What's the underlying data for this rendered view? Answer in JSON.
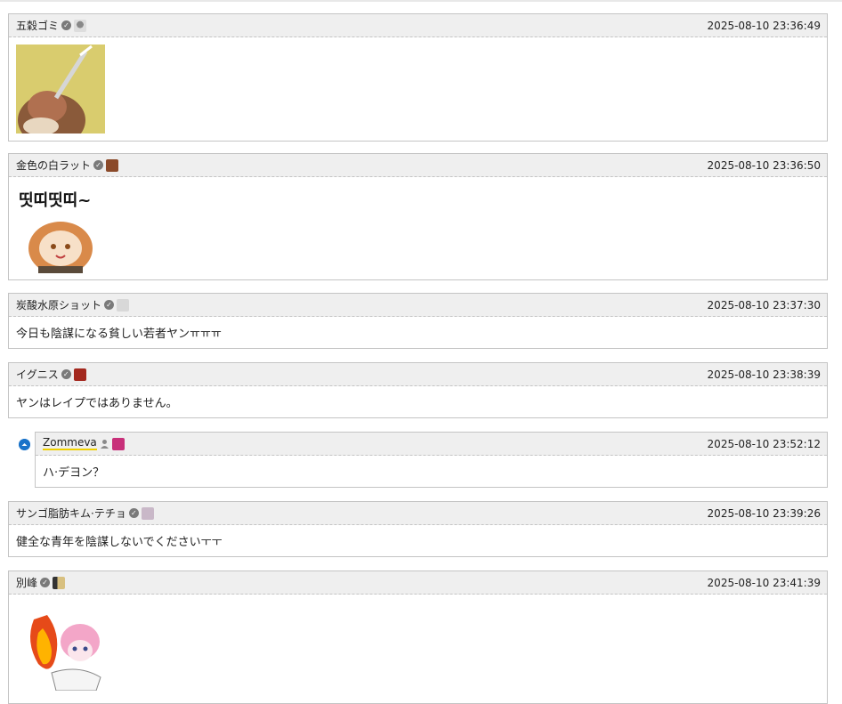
{
  "comments": [
    {
      "nick": "五穀ゴミ",
      "time": "2025-08-10 23:36:49",
      "type": "image",
      "image": "sticker-girl-with-brush"
    },
    {
      "nick": "金色の白ラット",
      "time": "2025-08-10 23:36:50",
      "type": "image",
      "image": "sticker-띳띠띳띠",
      "sticker_text": "띳띠띳띠~"
    },
    {
      "nick": "炭酸水原ショット",
      "time": "2025-08-10 23:37:30",
      "type": "text",
      "text": "今日も陰謀になる貧しい若者ヤンㅠㅠㅠ"
    },
    {
      "nick": "イグニス",
      "time": "2025-08-10 23:38:39",
      "type": "text",
      "text": "ヤンはレイプではありません。"
    },
    {
      "nick": "Zommeva",
      "time": "2025-08-10 23:52:12",
      "type": "text",
      "text": "ハ·デヨン？",
      "is_reply": true
    },
    {
      "nick": "サンゴ脂肪キム·テチョ",
      "time": "2025-08-10 23:39:26",
      "type": "text",
      "text": "健全な青年を陰謀しないでくださいㅜㅜ"
    },
    {
      "nick": "別峰",
      "time": "2025-08-10 23:41:39",
      "type": "image",
      "image": "sticker-pink-hair-fire"
    }
  ],
  "icons": {
    "verified": "check-circle-icon",
    "member": "person-icon",
    "reply": "reply-arrow-icon"
  },
  "colors": {
    "header_bg": "#efefef",
    "border": "#c4c4c4",
    "reply_icon": "#1a73c9",
    "member_underline": "#f0d000"
  }
}
